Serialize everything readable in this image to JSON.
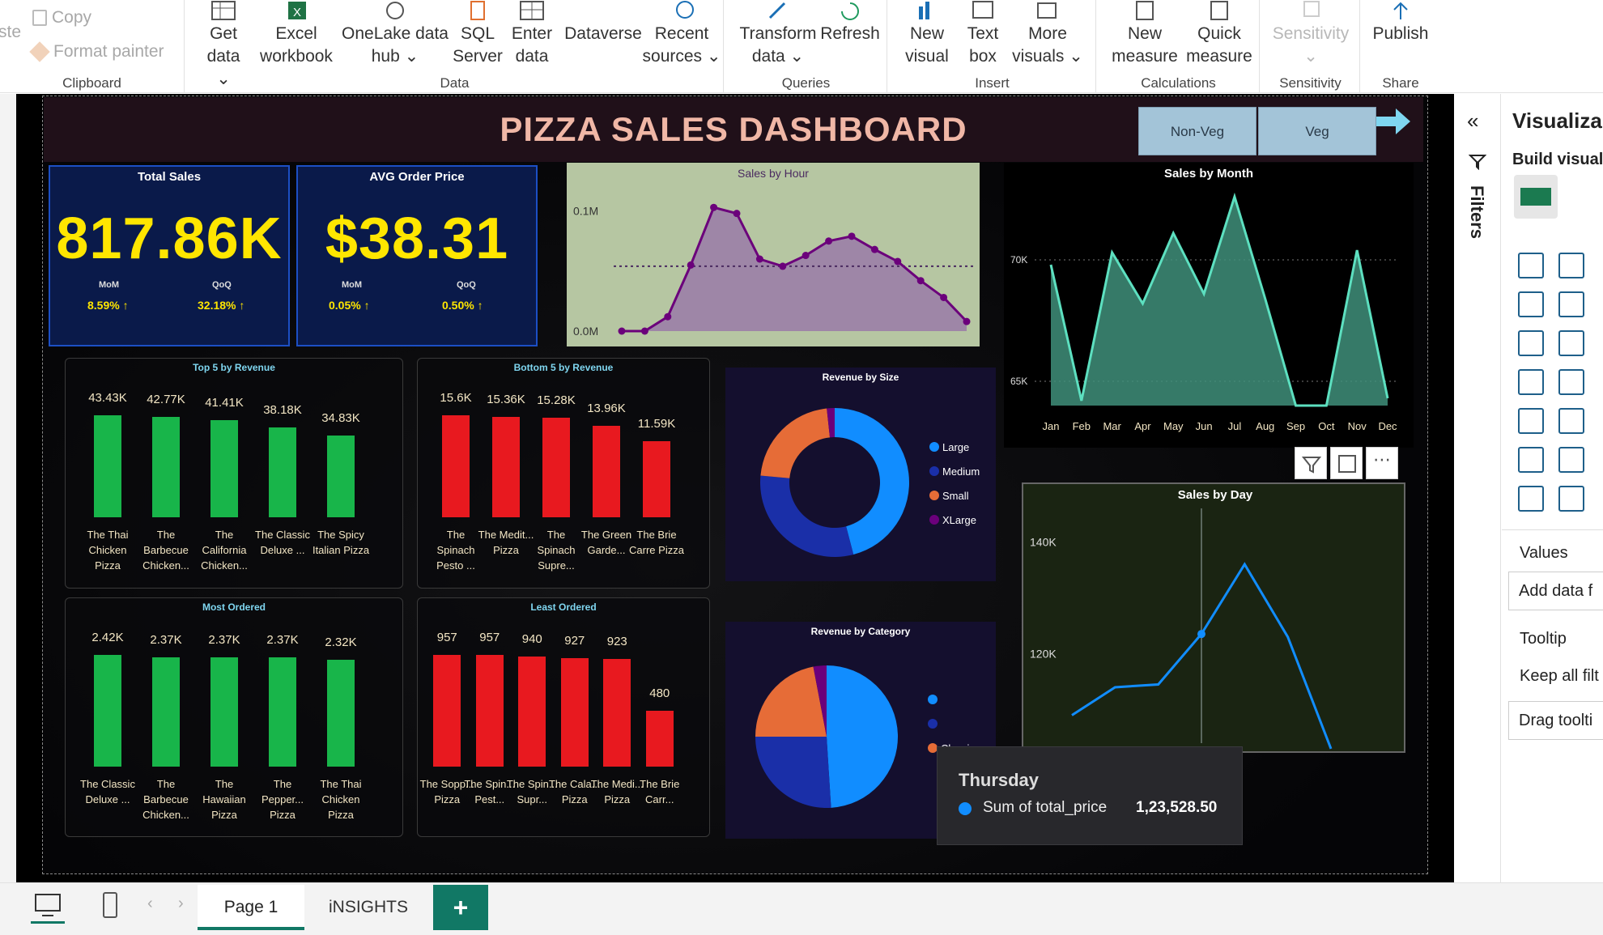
{
  "ribbon": {
    "clipboard": {
      "label": "Clipboard",
      "copy": "Copy",
      "format_painter": "Format painter",
      "paste": "ste"
    },
    "data": {
      "label": "Data",
      "get_data": [
        "Get",
        "data"
      ],
      "excel": [
        "Excel",
        "workbook"
      ],
      "onelake": [
        "OneLake data",
        "hub"
      ],
      "sql": [
        "SQL",
        "Server"
      ],
      "enter": [
        "Enter",
        "data"
      ],
      "dataverse": "Dataverse",
      "recent": [
        "Recent",
        "sources"
      ]
    },
    "queries": {
      "label": "Queries",
      "transform": [
        "Transform",
        "data"
      ],
      "refresh": "Refresh"
    },
    "insert": {
      "label": "Insert",
      "new_visual": [
        "New",
        "visual"
      ],
      "text_box": [
        "Text",
        "box"
      ],
      "more_visuals": [
        "More",
        "visuals"
      ]
    },
    "calculations": {
      "label": "Calculations",
      "new_measure": [
        "New",
        "measure"
      ],
      "quick_measure": [
        "Quick",
        "measure"
      ]
    },
    "sensitivity": {
      "label": "Sensitivity",
      "button": "Sensitivity"
    },
    "share": {
      "label": "Share",
      "publish": "Publish"
    }
  },
  "report": {
    "title": "PIZZA SALES DASHBOARD",
    "slicers": [
      "Non-Veg",
      "Veg"
    ],
    "cards": [
      {
        "title": "Total Sales",
        "value": "817.86K",
        "kpis": [
          {
            "label": "MoM",
            "value": "8.59% ↑"
          },
          {
            "label": "QoQ",
            "value": "32.18% ↑"
          }
        ]
      },
      {
        "title": "AVG Order Price",
        "value": "$38.31",
        "kpis": [
          {
            "label": "MoM",
            "value": "0.05% ↑"
          },
          {
            "label": "QoQ",
            "value": "0.50% ↑"
          }
        ]
      }
    ]
  },
  "chart_data": [
    {
      "type": "area",
      "title": "Sales by Hour",
      "ytick_labels": [
        "0.0M",
        "0.1M"
      ],
      "ylim": [
        0,
        0.12
      ],
      "values": [
        0.0,
        0.0,
        0.012,
        0.055,
        0.103,
        0.098,
        0.06,
        0.054,
        0.063,
        0.075,
        0.079,
        0.068,
        0.058,
        0.042,
        0.028,
        0.008
      ],
      "average_line": 0.054
    },
    {
      "type": "area",
      "title": "Sales by Month",
      "categories": [
        "Jan",
        "Feb",
        "Mar",
        "Apr",
        "May",
        "Jun",
        "Jul",
        "Aug",
        "Sep",
        "Oct",
        "Nov",
        "Dec"
      ],
      "ytick_labels": [
        "65K",
        "70K"
      ],
      "yticks": [
        65000,
        70000
      ],
      "ylim": [
        64000,
        73000
      ],
      "values": [
        69800,
        64200,
        70300,
        68200,
        71100,
        68600,
        72600,
        68400,
        64000,
        64000,
        70400,
        64300
      ]
    },
    {
      "type": "bar",
      "title": "Top 5 by Revenue",
      "categories": [
        "The Thai Chicken Pizza",
        "The Barbecue Chicken...",
        "The California Chicken...",
        "The Classic Deluxe ...",
        "The Spicy Italian Pizza"
      ],
      "values": [
        43.43,
        42.77,
        41.41,
        38.18,
        34.83
      ],
      "value_labels": [
        "43.43K",
        "42.77K",
        "41.41K",
        "38.18K",
        "34.83K"
      ],
      "color": "#18b54a"
    },
    {
      "type": "bar",
      "title": "Bottom 5 by Revenue",
      "categories": [
        "The Spinach Pesto ...",
        "The Medit... Pizza",
        "The Spinach Supre...",
        "The Green Garde...",
        "The Brie Carre Pizza"
      ],
      "values": [
        15.6,
        15.36,
        15.28,
        13.96,
        11.59
      ],
      "value_labels": [
        "15.6K",
        "15.36K",
        "15.28K",
        "13.96K",
        "11.59K"
      ],
      "color": "#e8191f"
    },
    {
      "type": "bar",
      "title": "Most Ordered",
      "categories": [
        "The Classic Deluxe ...",
        "The Barbecue Chicken...",
        "The Hawaiian Pizza",
        "The Pepper... Pizza",
        "The Thai Chicken Pizza"
      ],
      "values": [
        2.42,
        2.37,
        2.37,
        2.37,
        2.32
      ],
      "value_labels": [
        "2.42K",
        "2.37K",
        "2.37K",
        "2.37K",
        "2.32K"
      ],
      "color": "#18b54a"
    },
    {
      "type": "bar",
      "title": "Least Ordered",
      "categories": [
        "The Sopp... Pizza",
        "The Spin... Pest...",
        "The Spin... Supr...",
        "The Cala... Pizza",
        "The Medi... Pizza",
        "The Brie Carr..."
      ],
      "values": [
        957,
        957,
        940,
        927,
        923,
        480
      ],
      "value_labels": [
        "957",
        "957",
        "940",
        "927",
        "923",
        "480"
      ],
      "color": "#e8191f"
    },
    {
      "type": "pie",
      "title": "Revenue by Size",
      "donut": true,
      "labels": [
        "Large",
        "Medium",
        "Small",
        "XLarge"
      ],
      "values": [
        45.9,
        30.5,
        21.8,
        1.7
      ],
      "colors": [
        "#118dff",
        "#1a2fa8",
        "#e66c37",
        "#6b007b"
      ]
    },
    {
      "type": "pie",
      "title": "Revenue by Category",
      "labels": [
        "",
        "",
        "Classic ..."
      ],
      "values": [
        49,
        26,
        22,
        3
      ],
      "colors": [
        "#118dff",
        "#1a2fa8",
        "#e66c37",
        "#6b007b"
      ],
      "legend_visible": [
        "",
        "",
        "Classic ..."
      ]
    },
    {
      "type": "line",
      "title": "Sales by Day",
      "ytick_labels": [
        "120K",
        "140K"
      ],
      "yticks": [
        120000,
        140000
      ],
      "ylim": [
        104000,
        146000
      ],
      "values": [
        109000,
        114000,
        114500,
        123528.5,
        136000,
        123000,
        103000
      ],
      "hover_index": 3
    }
  ],
  "tooltip": {
    "title": "Thursday",
    "label": "Sum of total_price",
    "value": "1,23,528.50"
  },
  "visual_header": {
    "filter_icon": "filter-icon",
    "focus_icon": "focus-mode-icon",
    "more_icon": "more-options-icon"
  },
  "filters_pane": {
    "label": "Filters"
  },
  "viz_pane": {
    "title": "Visualiza",
    "build": "Build visual",
    "values": "Values",
    "add_data": "Add data f",
    "tooltip": "Tooltip",
    "keep_all": "Keep all filt",
    "drag": "Drag toolti"
  },
  "pages": {
    "tabs": [
      "Page 1",
      "iNSIGHTS"
    ],
    "add": "+"
  }
}
